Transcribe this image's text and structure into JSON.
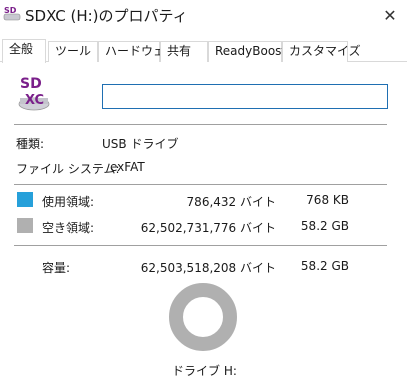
{
  "window": {
    "title": "SDXC (H:)のプロパティ",
    "close_glyph": "✕",
    "icon": "usb-drive-icon"
  },
  "tabs": [
    {
      "label": "全般",
      "active": true
    },
    {
      "label": "ツール",
      "active": false
    },
    {
      "label": "ハードウェア",
      "active": false
    },
    {
      "label": "共有",
      "active": false
    },
    {
      "label": "ReadyBoost",
      "active": false
    },
    {
      "label": "カスタマイズ",
      "active": false
    }
  ],
  "general": {
    "drive_icon_text": "SD\nXC",
    "volume_name_value": "",
    "type_label": "種類:",
    "type_value": "USB ドライブ",
    "fs_label": "ファイル システム:",
    "fs_value": "exFAT",
    "used": {
      "label": "使用領域:",
      "bytes": "786,432 バイト",
      "size": "768 KB",
      "color": "#26a0da"
    },
    "free": {
      "label": "空き領域:",
      "bytes": "62,502,731,776 バイト",
      "size": "58.2 GB",
      "color": "#b0b0b0"
    },
    "capacity": {
      "label": "容量:",
      "bytes": "62,503,518,208 バイト",
      "size": "58.2 GB"
    },
    "used_fraction": 1.26e-05,
    "drive_label": "ドライブ H:"
  }
}
